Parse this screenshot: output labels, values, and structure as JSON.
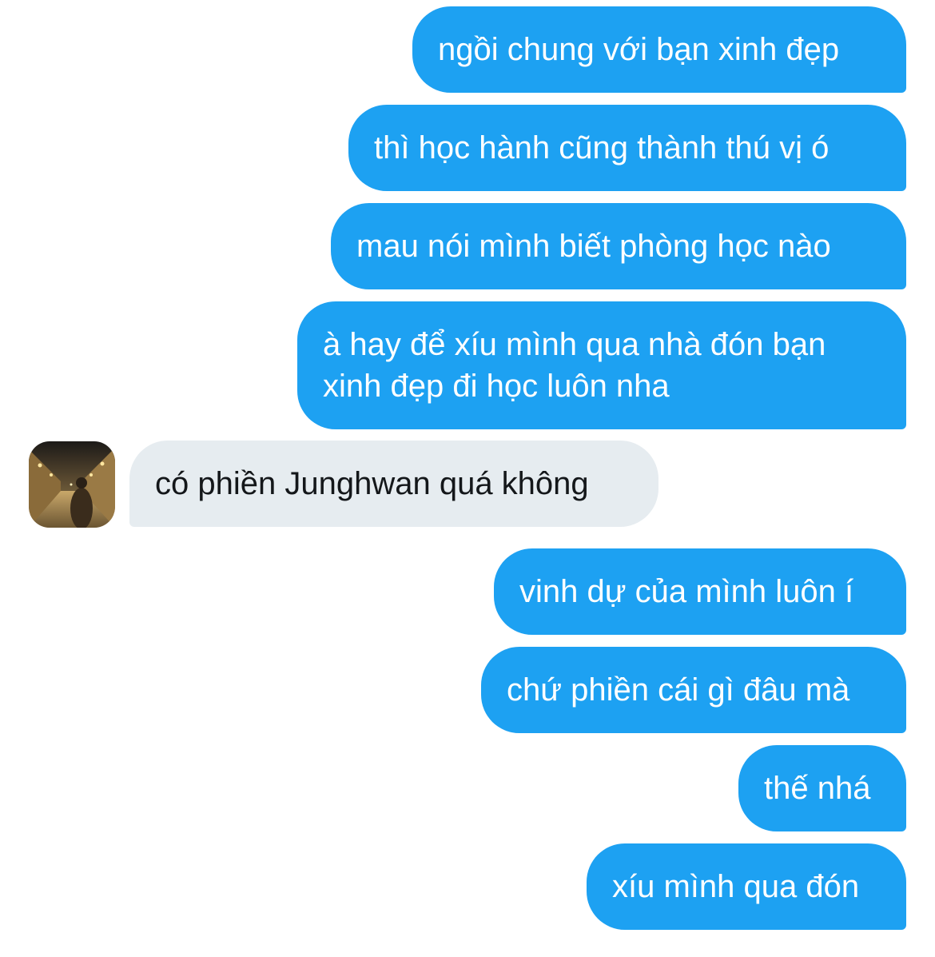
{
  "conversation": {
    "messages": [
      {
        "side": "out",
        "text": "ngồi chung với bạn xinh đẹp"
      },
      {
        "side": "out",
        "text": "thì học hành cũng thành thú vị ó"
      },
      {
        "side": "out",
        "text": "mau nói mình biết phòng học nào"
      },
      {
        "side": "out",
        "text": "à hay để xíu mình qua nhà đón bạn xinh đẹp đi học luôn nha"
      },
      {
        "side": "in",
        "text": "có phiền Junghwan quá không"
      },
      {
        "side": "out",
        "text": "vinh dự của mình luôn í"
      },
      {
        "side": "out",
        "text": "chứ phiền cái gì đâu mà"
      },
      {
        "side": "out",
        "text": "thế nhá"
      },
      {
        "side": "out",
        "text": "xíu mình qua đón"
      }
    ]
  },
  "colors": {
    "outgoing_bubble": "#1da1f2",
    "incoming_bubble": "#e6ecf0",
    "outgoing_text": "#ffffff",
    "incoming_text": "#14171a"
  },
  "icons": {
    "avatar": "contact-avatar-night-street-photo"
  }
}
